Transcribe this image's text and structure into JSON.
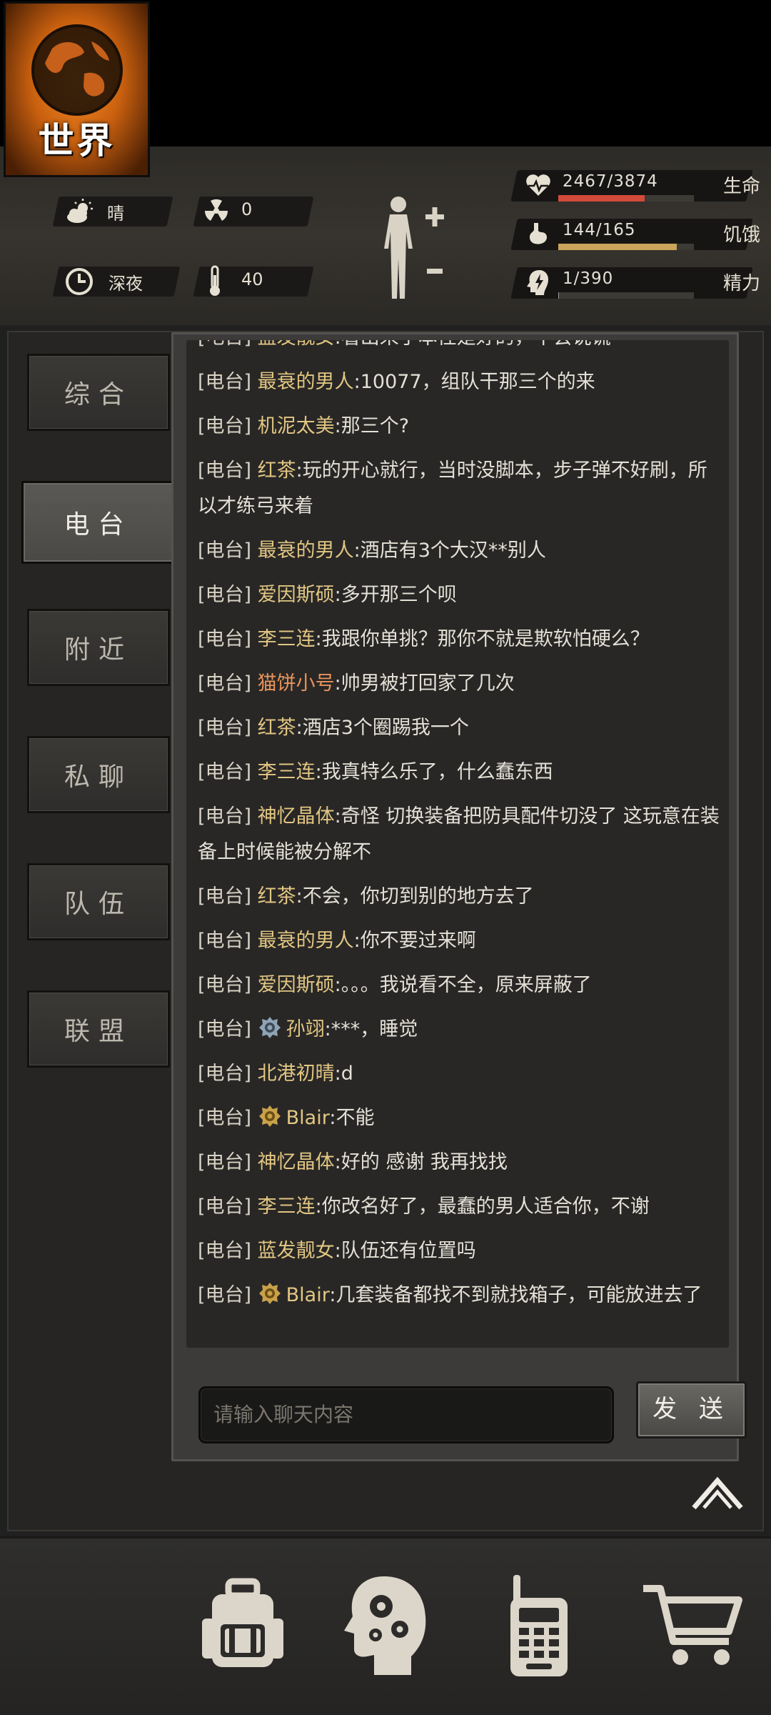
{
  "status": {
    "weather": "晴",
    "radiation": "0",
    "time_of_day": "深夜",
    "temperature": "40",
    "health": {
      "value": "2467/3874",
      "label": "生命",
      "fraction": 0.637,
      "color": "#d24a3a"
    },
    "hunger": {
      "value": "144/165",
      "label": "饥饿",
      "fraction": 0.873,
      "color": "#c9a45a"
    },
    "energy": {
      "value": "1/390",
      "label": "精力",
      "fraction": 0.003,
      "color": "#9a9a9a"
    }
  },
  "tabs": [
    {
      "label": "综合",
      "active": false
    },
    {
      "label": "电台",
      "active": true
    },
    {
      "label": "附近",
      "active": false
    },
    {
      "label": "私聊",
      "active": false
    },
    {
      "label": "队伍",
      "active": false
    },
    {
      "label": "联盟",
      "active": false
    }
  ],
  "chat": {
    "messages": [
      {
        "channel": "[电台]",
        "name": "蓝发靓女",
        "text": ":看出来了本性是好的，不会说谎",
        "badge": ""
      },
      {
        "channel": "[电台]",
        "name": "最衰的男人",
        "text": ":10077，组队干那三个的来",
        "badge": ""
      },
      {
        "channel": "[电台]",
        "name": "机泥太美",
        "text": ":那三个?",
        "badge": ""
      },
      {
        "channel": "[电台]",
        "name": "红茶",
        "text": ":玩的开心就行，当时没脚本，步子弹不好刷，所以才练弓来着",
        "badge": ""
      },
      {
        "channel": "[电台]",
        "name": "最衰的男人",
        "text": ":酒店有3个大汉**别人",
        "badge": ""
      },
      {
        "channel": "[电台]",
        "name": "爱因斯硕",
        "text": ":多开那三个呗",
        "badge": ""
      },
      {
        "channel": "[电台]",
        "name": "李三连",
        "text": ":我跟你单挑？那你不就是欺软怕硬么？",
        "badge": ""
      },
      {
        "channel": "[电台]",
        "name": "猫饼小号",
        "text": ":帅男被打回家了几次",
        "badge": "",
        "orange": true
      },
      {
        "channel": "[电台]",
        "name": "红茶",
        "text": ":酒店3个圈踢我一个",
        "badge": ""
      },
      {
        "channel": "[电台]",
        "name": "李三连",
        "text": ":我真特么乐了，什么蠢东西",
        "badge": ""
      },
      {
        "channel": "[电台]",
        "name": "神忆晶体",
        "text": ":奇怪 切换装备把防具配件切没了 这玩意在装备上时候能被分解不",
        "badge": ""
      },
      {
        "channel": "[电台]",
        "name": "红茶",
        "text": ":不会，你切到别的地方去了",
        "badge": ""
      },
      {
        "channel": "[电台]",
        "name": "最衰的男人",
        "text": ":你不要过来啊",
        "badge": ""
      },
      {
        "channel": "[电台]",
        "name": "爱因斯硕",
        "text": ":。。。我说看不全，原来屏蔽了",
        "badge": ""
      },
      {
        "channel": "[电台]",
        "name": "孙翊",
        "text": ":***，睡觉",
        "badge": "silver"
      },
      {
        "channel": "[电台]",
        "name": "北港初晴",
        "text": ":d",
        "badge": ""
      },
      {
        "channel": "[电台]",
        "name": "Blair",
        "text": ":不能",
        "badge": "gold"
      },
      {
        "channel": "[电台]",
        "name": "神忆晶体",
        "text": ":好的 感谢 我再找找",
        "badge": ""
      },
      {
        "channel": "[电台]",
        "name": "李三连",
        "text": ":你改名好了，最蠢的男人适合你，不谢",
        "badge": ""
      },
      {
        "channel": "[电台]",
        "name": "蓝发靓女",
        "text": ":队伍还有位置吗",
        "badge": ""
      },
      {
        "channel": "[电台]",
        "name": "Blair",
        "text": ":几套装备都找不到就找箱子，可能放进去了",
        "badge": "gold"
      }
    ],
    "input_placeholder": "请输入聊天内容",
    "send_label": "发 送"
  },
  "nav": {
    "world_label": "世界",
    "items": [
      "backpack-icon",
      "head-gears-icon",
      "walkie-talkie-icon",
      "cart-icon"
    ]
  }
}
